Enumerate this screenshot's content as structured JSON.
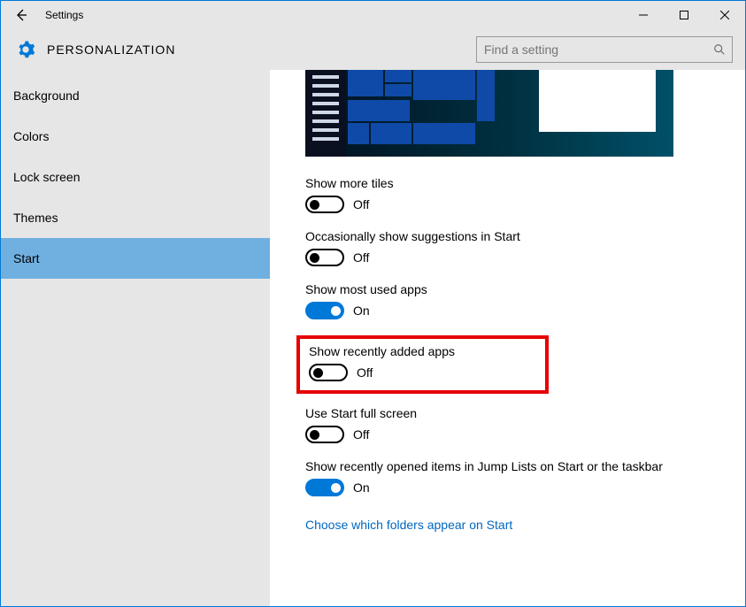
{
  "window": {
    "title": "Settings"
  },
  "header": {
    "category": "PERSONALIZATION",
    "search_placeholder": "Find a setting"
  },
  "sidebar": {
    "items": [
      {
        "label": "Background"
      },
      {
        "label": "Colors"
      },
      {
        "label": "Lock screen"
      },
      {
        "label": "Themes"
      },
      {
        "label": "Start"
      }
    ],
    "active_index": 4
  },
  "settings": [
    {
      "label": "Show more tiles",
      "on": false,
      "state": "Off",
      "highlight": false
    },
    {
      "label": "Occasionally show suggestions in Start",
      "on": false,
      "state": "Off",
      "highlight": false
    },
    {
      "label": "Show most used apps",
      "on": true,
      "state": "On",
      "highlight": false
    },
    {
      "label": "Show recently added apps",
      "on": false,
      "state": "Off",
      "highlight": true
    },
    {
      "label": "Use Start full screen",
      "on": false,
      "state": "Off",
      "highlight": false
    },
    {
      "label": "Show recently opened items in Jump Lists on Start or the taskbar",
      "on": true,
      "state": "On",
      "highlight": false
    }
  ],
  "link": {
    "label": "Choose which folders appear on Start"
  }
}
